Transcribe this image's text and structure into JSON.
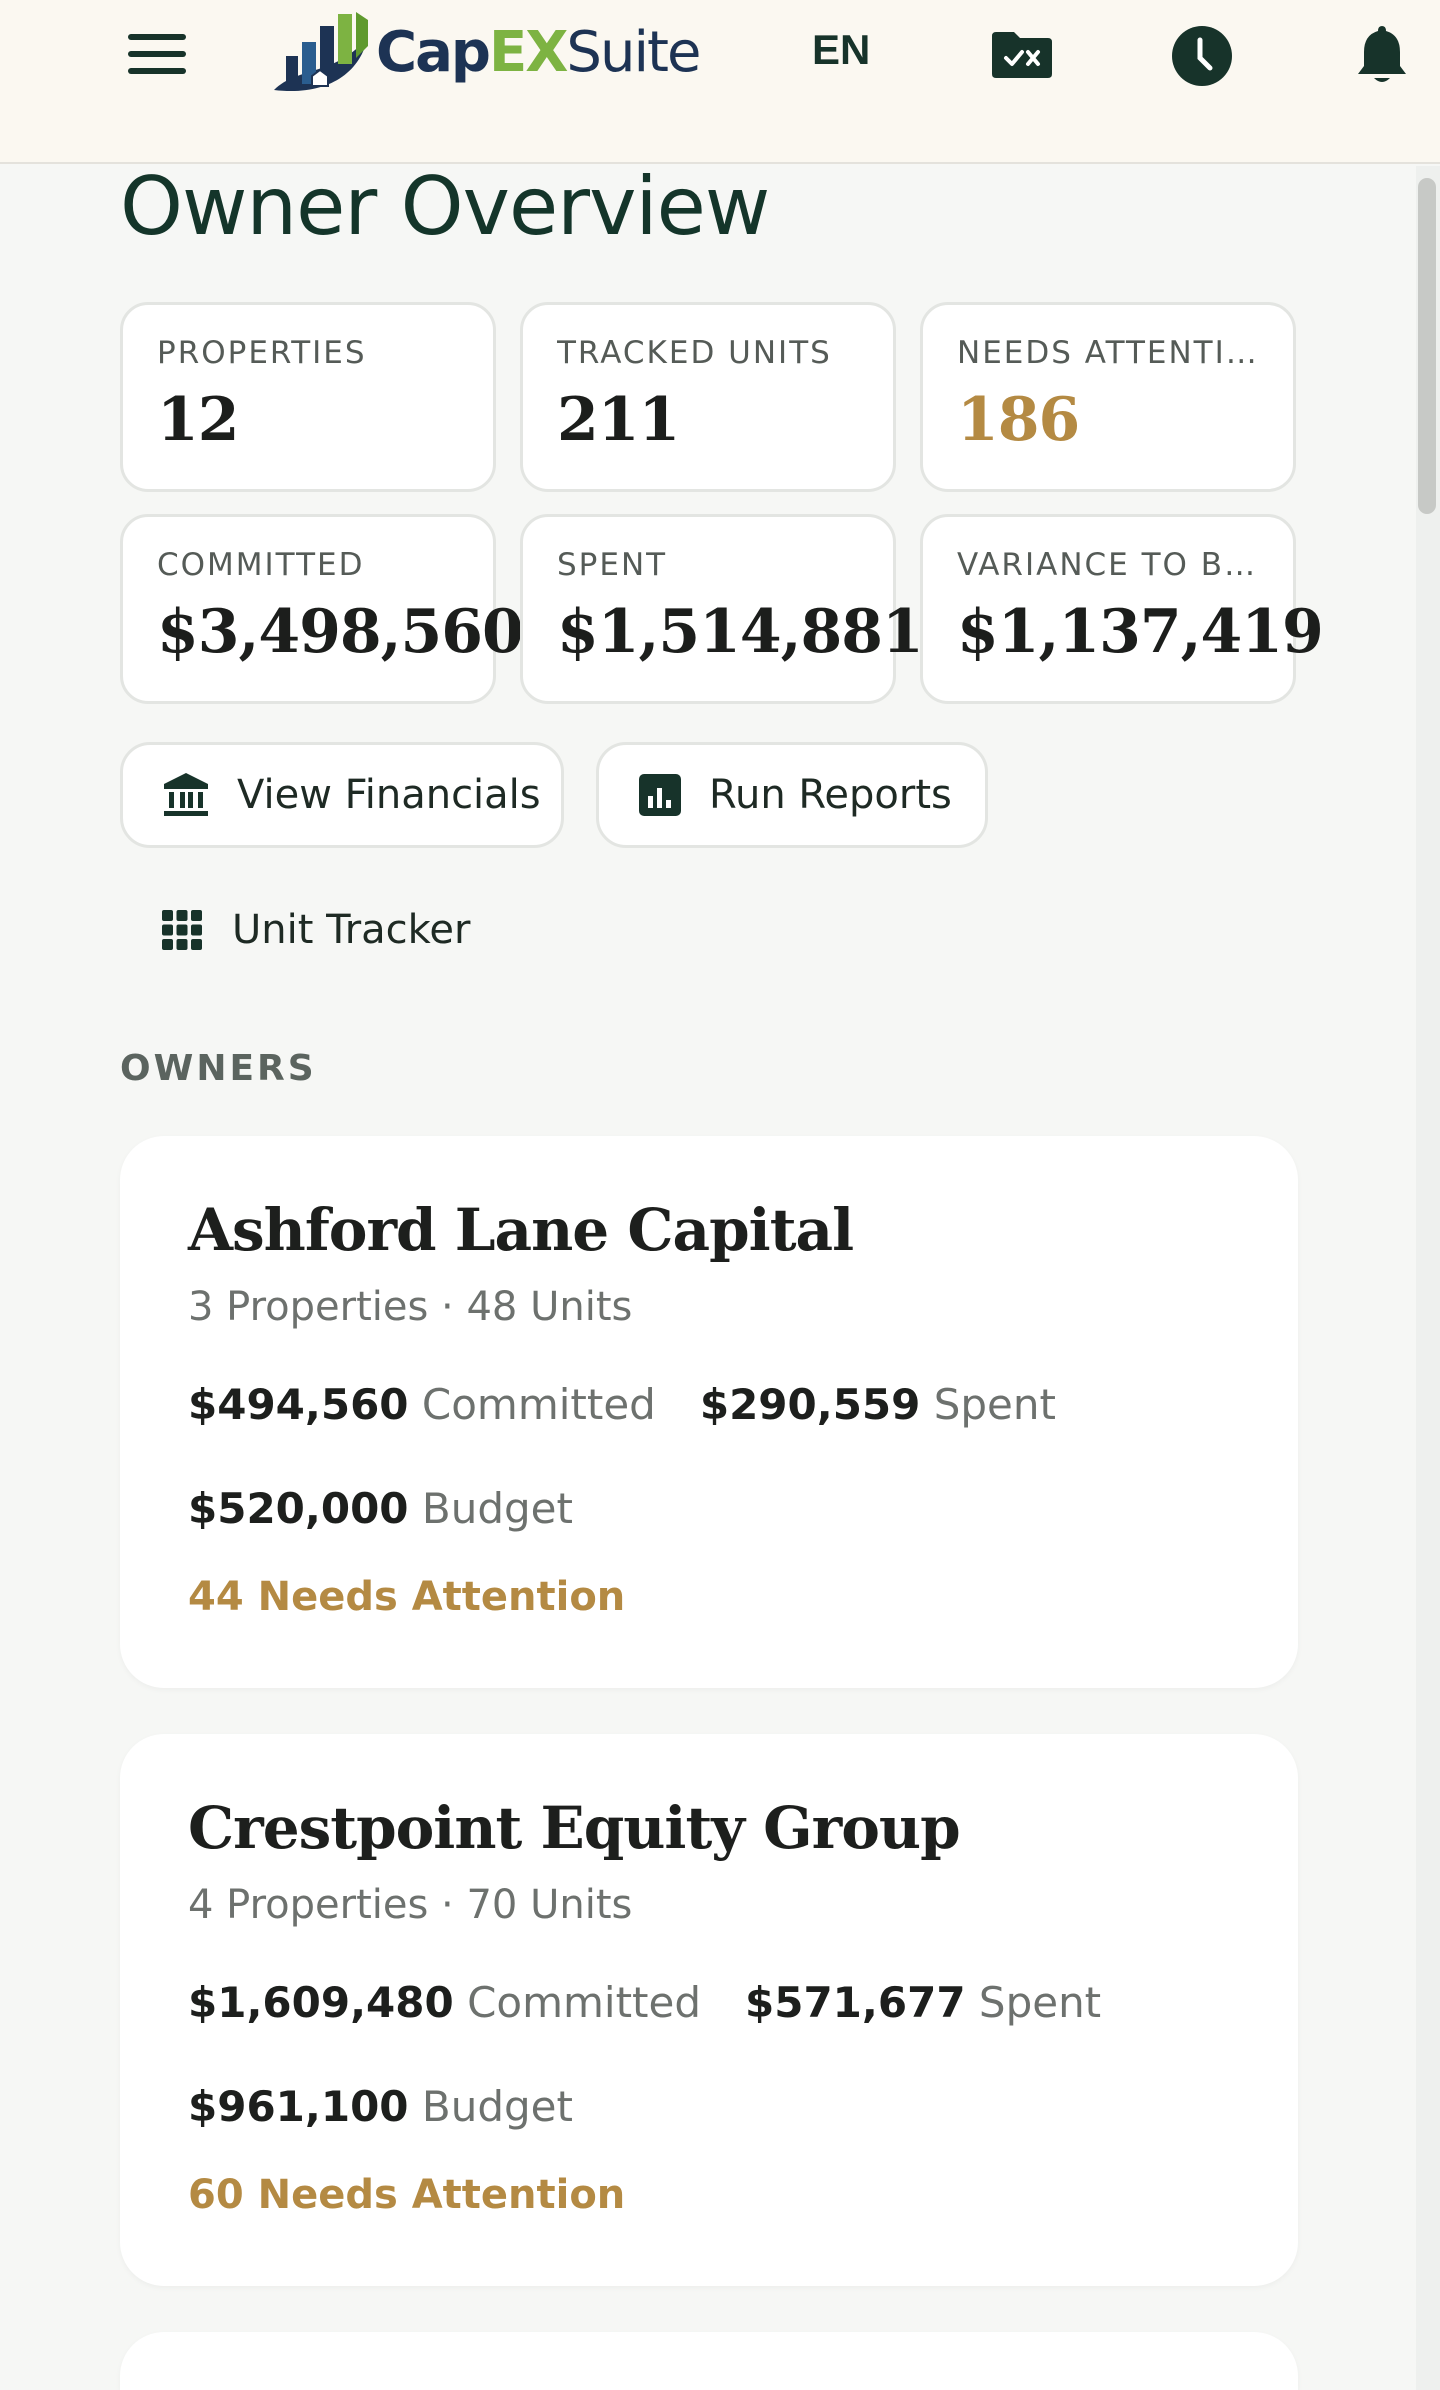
{
  "header": {
    "app_name_part1": "Cap",
    "app_name_part2": "EX",
    "app_name_part3": "Suite",
    "language": "EN",
    "icons": [
      "menu-icon",
      "folder-check-icon",
      "clock-icon",
      "bell-icon"
    ]
  },
  "page": {
    "title": "Owner Overview",
    "section_label": "OWNERS"
  },
  "stats": [
    {
      "label": "PROPERTIES",
      "value": "12"
    },
    {
      "label": "TRACKED UNITS",
      "value": "211"
    },
    {
      "label": "NEEDS ATTENTI…",
      "value": "186"
    },
    {
      "label": "COMMITTED",
      "value": "$3,498,560"
    },
    {
      "label": "SPENT",
      "value": "$1,514,881"
    },
    {
      "label": "VARIANCE TO BU…",
      "value": "$1,137,419"
    }
  ],
  "actions": {
    "view_financials": "View Financials",
    "run_reports": "Run Reports",
    "unit_tracker": "Unit Tracker"
  },
  "owners": [
    {
      "name": "Ashford Lane Capital",
      "subtitle": "3 Properties · 48 Units",
      "committed": "$494,560",
      "committed_label": "Committed",
      "spent": "$290,559",
      "spent_label": "Spent",
      "budget": "$520,000",
      "budget_label": "Budget",
      "attention": "44 Needs Attention"
    },
    {
      "name": "Crestpoint Equity Group",
      "subtitle": "4 Properties · 70 Units",
      "committed": "$1,609,480",
      "committed_label": "Committed",
      "spent": "$571,677",
      "spent_label": "Spent",
      "budget": "$961,100",
      "budget_label": "Budget",
      "attention": "60 Needs Attention"
    }
  ],
  "colors": {
    "brand_dark": "#14352a",
    "accent_gold": "#b48a43",
    "logo_green": "#7db342",
    "logo_navy": "#1d3354"
  }
}
